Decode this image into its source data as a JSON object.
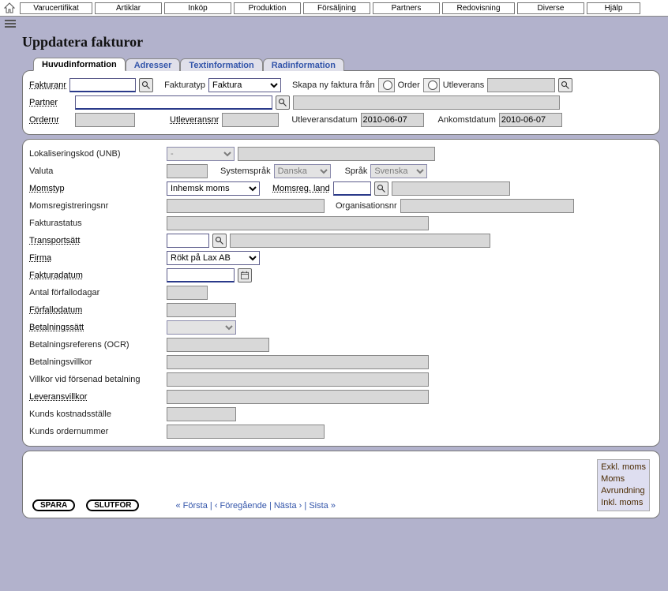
{
  "menu": {
    "home": "home",
    "items": [
      "Varucertifikat",
      "Artiklar",
      "Inköp",
      "Produktion",
      "Försäljning",
      "Partners",
      "Redovisning",
      "Diverse",
      "Hjälp"
    ]
  },
  "page": {
    "title": "Uppdatera fakturor"
  },
  "tabs": [
    "Huvudinformation",
    "Adresser",
    "Textinformation",
    "Radinformation"
  ],
  "s1": {
    "fakturanr": "Fakturanr",
    "fakturatyp_lbl": "Fakturatyp",
    "fakturatyp_val": "Faktura",
    "skapa_lbl": "Skapa ny faktura från",
    "order": "Order",
    "utlev": "Utleverans",
    "partner": "Partner",
    "ordernr": "Ordernr",
    "utleveransnr": "Utleveransnr",
    "utleveransdatum": "Utleveransdatum",
    "utleveransdatum_v": "2010-06-07",
    "ankomstdatum": "Ankomstdatum",
    "ankomstdatum_v": "2010-06-07"
  },
  "s2": {
    "lokkod": "Lokaliseringskod (UNB)",
    "lokkod_v": "-",
    "valuta": "Valuta",
    "systemsprak": "Systemspråk",
    "systemsprak_v": "Danska",
    "sprak": "Språk",
    "sprak_v": "Svenska",
    "momstyp": "Momstyp",
    "momstyp_v": "Inhemsk moms",
    "momsregland": "Momsreg. land",
    "momsregnr": "Momsregistreringsnr",
    "orgnr": "Organisationsnr",
    "fakturastatus": "Fakturastatus",
    "transportsatt": "Transportsätt",
    "firma": "Firma",
    "firma_v": "Rökt på Lax AB",
    "fakturadatum": "Fakturadatum",
    "antal": "Antal förfallodagar",
    "forfallodatum": "Förfallodatum",
    "betalningssatt": "Betalningssätt",
    "betalningssatt_v": "",
    "betref": "Betalningsreferens (OCR)",
    "betvillkor": "Betalningsvillkor",
    "villkorforsenad": "Villkor vid försenad betalning",
    "levvillkor": "Leveransvillkor",
    "kundskost": "Kunds kostnadsställe",
    "kundsord": "Kunds ordernummer"
  },
  "footer": {
    "spara": "SPARA",
    "slutfor": "SLUTFÖR",
    "forsta": "« Första",
    "foregaende": "‹ Föregående",
    "nasta": "Nästa ›",
    "sista": "Sista »",
    "sep": " | "
  },
  "totals": {
    "exkl": "Exkl. moms",
    "moms": "Moms",
    "avr": "Avrundning",
    "inkl": "Inkl. moms"
  }
}
